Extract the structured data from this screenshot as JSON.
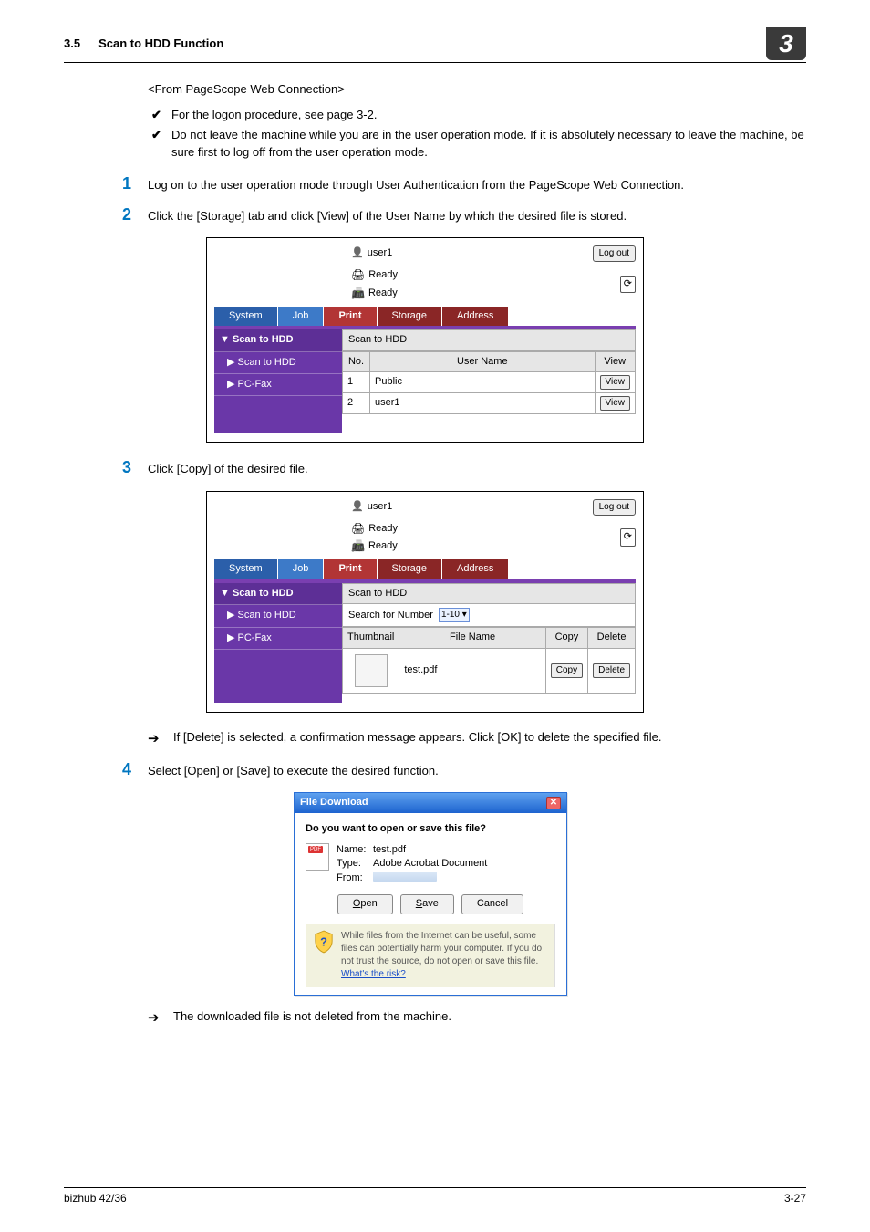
{
  "header": {
    "section": "3.5",
    "title": "Scan to HDD Function",
    "chapter": "3"
  },
  "subhead": "<From PageScope Web Connection>",
  "bullets": [
    "For the logon procedure, see page 3-2.",
    "Do not leave the machine while you are in the user operation mode. If it is absolutely necessary to leave the machine, be sure first to log off from the user operation mode."
  ],
  "steps": {
    "s1": "Log on to the user operation mode through User Authentication from the PageScope Web Connection.",
    "s2": "Click the [Storage] tab and click [View] of the User Name by which the desired file is stored.",
    "s3": "Click [Copy] of the desired file.",
    "s3note": "If [Delete] is selected, a confirmation message appears. Click [OK] to delete the specified file.",
    "s4": "Select [Open] or [Save] to execute the desired function.",
    "s4note": "The downloaded file is not deleted from the machine."
  },
  "web": {
    "user": "user1",
    "logout": "Log out",
    "ready": "Ready",
    "tabs": {
      "system": "System",
      "job": "Job",
      "print": "Print",
      "storage": "Storage",
      "address": "Address"
    },
    "side": {
      "head": "▼ Scan to HDD",
      "scan": "▶ Scan to HDD",
      "pcfax": "▶ PC-Fax"
    },
    "panel1": {
      "title": "Scan to HDD",
      "cols": {
        "no": "No.",
        "user": "User Name",
        "view": "View"
      },
      "rows": [
        {
          "no": "1",
          "user": "Public",
          "view": "View"
        },
        {
          "no": "2",
          "user": "user1",
          "view": "View"
        }
      ]
    },
    "panel2": {
      "title": "Scan to HDD",
      "searchLabel": "Search for Number",
      "searchRange": "1-10",
      "cols": {
        "thumb": "Thumbnail",
        "file": "File Name",
        "copy": "Copy",
        "del": "Delete"
      },
      "row": {
        "file": "test.pdf",
        "copy": "Copy",
        "del": "Delete"
      }
    }
  },
  "dialog": {
    "title": "File Download",
    "question": "Do you want to open or save this file?",
    "nameK": "Name:",
    "nameV": "test.pdf",
    "typeK": "Type:",
    "typeV": "Adobe Acrobat Document",
    "fromK": "From:",
    "open": "Open",
    "save": "Save",
    "cancel": "Cancel",
    "warn": "While files from the Internet can be useful, some files can potentially harm your computer. If you do not trust the source, do not open or save this file. ",
    "risk": "What's the risk?"
  },
  "footer": {
    "left": "bizhub 42/36",
    "right": "3-27"
  }
}
